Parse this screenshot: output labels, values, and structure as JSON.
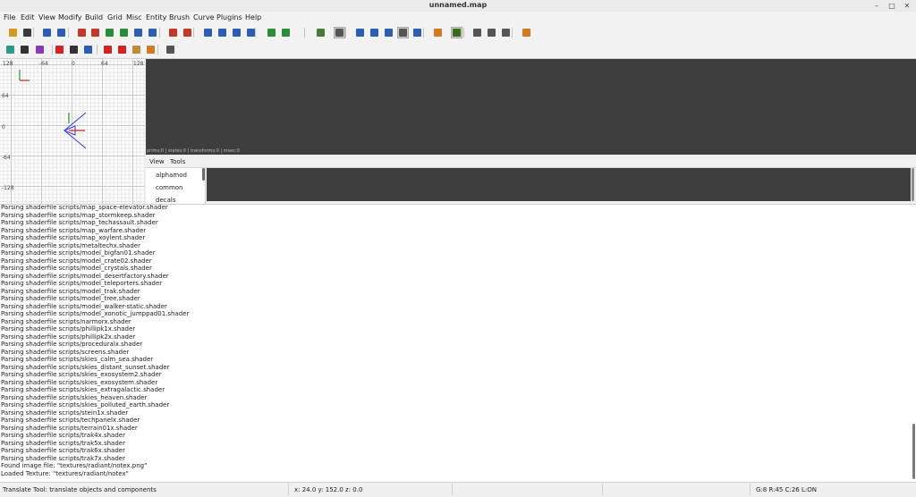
{
  "window": {
    "title": "unnamed.map",
    "controls": {
      "minimize": "–",
      "maximize": "□",
      "close": "✕"
    }
  },
  "menu": [
    "File",
    "Edit",
    "View",
    "Modify",
    "Build",
    "Grid",
    "Misc",
    "Entity",
    "Brush",
    "Curve",
    "Plugins",
    "Help"
  ],
  "toolbar1": [
    {
      "name": "open-icon",
      "color": "#d29a22"
    },
    {
      "name": "save-icon",
      "color": "#3a3a3a"
    },
    {
      "name": "undo-icon",
      "color": "#2d5fb0"
    },
    {
      "name": "redo-icon",
      "color": "#2d5fb0"
    },
    {
      "name": "flip-x-icon",
      "color": "#c0392b"
    },
    {
      "name": "rotate-x-icon",
      "color": "#c0392b"
    },
    {
      "name": "flip-y-icon",
      "color": "#2e8b3a"
    },
    {
      "name": "rotate-y-icon",
      "color": "#2e8b3a"
    },
    {
      "name": "flip-z-icon",
      "color": "#2d5fb0"
    },
    {
      "name": "rotate-z-icon",
      "color": "#2d5fb0"
    },
    {
      "name": "csg-subtract-icon",
      "color": "#c0392b"
    },
    {
      "name": "csg-merge-icon",
      "color": "#c0392b"
    },
    {
      "name": "select-inside-icon",
      "color": "#2d5fb0"
    },
    {
      "name": "select-touching-icon",
      "color": "#2d5fb0"
    },
    {
      "name": "select-partial-icon",
      "color": "#2d5fb0"
    },
    {
      "name": "select-complete-icon",
      "color": "#2d5fb0"
    },
    {
      "name": "hollow-icon",
      "color": "#2e8b3a"
    },
    {
      "name": "make-room-icon",
      "color": "#2e8b3a"
    },
    {
      "name": "clipper-icon",
      "color": "#4a7a3a"
    },
    {
      "name": "translate-tool-icon",
      "color": "#555555"
    },
    {
      "name": "rotate-tool-icon",
      "color": "#2d5fb0"
    },
    {
      "name": "scale-tool-icon",
      "color": "#2d5fb0"
    },
    {
      "name": "drag-tool-icon",
      "color": "#2d5fb0"
    },
    {
      "name": "select-mode-icon",
      "color": "#555555"
    },
    {
      "name": "resize-tool-icon",
      "color": "#2d5fb0"
    },
    {
      "name": "camera-icon",
      "color": "#d27a22"
    },
    {
      "name": "texture-lock-icon",
      "color": "#3a6a1a"
    },
    {
      "name": "entity-list-icon",
      "color": "#555555"
    },
    {
      "name": "surface-inspector-icon",
      "color": "#555555"
    },
    {
      "name": "filter-icon",
      "color": "#555555"
    },
    {
      "name": "patch-inspector-icon",
      "color": "#d27a22"
    }
  ],
  "toolbar2": [
    {
      "name": "cube-cycle-icon",
      "color": "#2d9a8a"
    },
    {
      "name": "ortho-view-icon",
      "color": "#333333"
    },
    {
      "name": "texture-view-icon",
      "color": "#8a3ab0"
    },
    {
      "name": "region-icon",
      "color": "#d22222"
    },
    {
      "name": "car-icon",
      "color": "#333333"
    },
    {
      "name": "brush-mode-icon",
      "color": "#2d5fb0"
    },
    {
      "name": "bend-icon",
      "color": "#d22222"
    },
    {
      "name": "cap-icon",
      "color": "#d22222"
    },
    {
      "name": "cat-icon",
      "color": "#c08a3a"
    },
    {
      "name": "thicken-icon",
      "color": "#d27a22"
    },
    {
      "name": "toggle-x-icon",
      "color": "#555555"
    }
  ],
  "gridview": {
    "top_labels": [
      "128",
      "-64",
      "0",
      "64",
      "128"
    ],
    "side_labels": [
      "64",
      "0",
      "-64",
      "-128"
    ]
  },
  "camera": {
    "stats": "prims:0 | states:0 | transforms:0 | msec:0"
  },
  "texture_browser": {
    "menu": [
      "View",
      "Tools"
    ],
    "dirs": [
      "alphamod",
      "common",
      "decals"
    ]
  },
  "console": {
    "lines": [
      "Parsing shaderfile scripts/map_space-elevator.shader",
      "Parsing shaderfile scripts/map_stormkeep.shader",
      "Parsing shaderfile scripts/map_techassault.shader",
      "Parsing shaderfile scripts/map_warfare.shader",
      "Parsing shaderfile scripts/map_xoylent.shader",
      "Parsing shaderfile scripts/metaltechx.shader",
      "Parsing shaderfile scripts/model_bigfan01.shader",
      "Parsing shaderfile scripts/model_crate02.shader",
      "Parsing shaderfile scripts/model_crystals.shader",
      "Parsing shaderfile scripts/model_desertfactory.shader",
      "Parsing shaderfile scripts/model_teleporters.shader",
      "Parsing shaderfile scripts/model_trak.shader",
      "Parsing shaderfile scripts/model_tree.shader",
      "Parsing shaderfile scripts/model_walker-static.shader",
      "Parsing shaderfile scripts/model_xonotic_jumppad01.shader",
      "Parsing shaderfile scripts/narmorx.shader",
      "Parsing shaderfile scripts/phillipk1x.shader",
      "Parsing shaderfile scripts/phillipk2x.shader",
      "Parsing shaderfile scripts/proceduralx.shader",
      "Parsing shaderfile scripts/screens.shader",
      "Parsing shaderfile scripts/skies_calm_sea.shader",
      "Parsing shaderfile scripts/skies_distant_sunset.shader",
      "Parsing shaderfile scripts/skies_exosystem2.shader",
      "Parsing shaderfile scripts/skies_exosystem.shader",
      "Parsing shaderfile scripts/skies_extragalactic.shader",
      "Parsing shaderfile scripts/skies_heaven.shader",
      "Parsing shaderfile scripts/skies_polluted_earth.shader",
      "Parsing shaderfile scripts/stein1x.shader",
      "Parsing shaderfile scripts/techpanelx.shader",
      "Parsing shaderfile scripts/terrain01x.shader",
      "Parsing shaderfile scripts/trak4x.shader",
      "Parsing shaderfile scripts/trak5x.shader",
      "Parsing shaderfile scripts/trak6x.shader",
      "Parsing shaderfile scripts/trak7x.shader",
      "Found image file: \"textures/radiant/notex.png\"",
      "Loaded Texture: \"textures/radiant/notex\""
    ]
  },
  "status": {
    "message": "Translate Tool: translate objects and components",
    "coords": "x:   24.0  y:  152.0  z:   0.0",
    "grid": "G:8  R:45  C:26  L:ON"
  }
}
